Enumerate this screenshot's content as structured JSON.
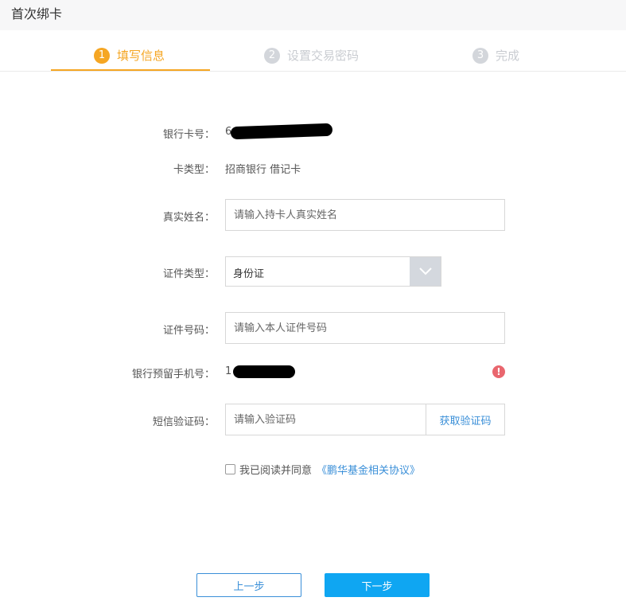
{
  "page": {
    "title": "首次绑卡"
  },
  "steps": [
    {
      "num": "1",
      "label": "填写信息",
      "active": true
    },
    {
      "num": "2",
      "label": "设置交易密码",
      "active": false
    },
    {
      "num": "3",
      "label": "完成",
      "active": false
    }
  ],
  "form": {
    "card_number": {
      "label": "银行卡号：",
      "value_prefix": "6"
    },
    "card_type": {
      "label": "卡类型：",
      "value": "招商银行 借记卡"
    },
    "real_name": {
      "label": "真实姓名：",
      "placeholder": "请输入持卡人真实姓名"
    },
    "id_type": {
      "label": "证件类型：",
      "value": "身份证"
    },
    "id_number": {
      "label": "证件号码：",
      "placeholder": "请输入本人证件号码"
    },
    "phone": {
      "label": "银行预留手机号：",
      "value_prefix": "1"
    },
    "sms_code": {
      "label": "短信验证码：",
      "placeholder": "请输入验证码",
      "button": "获取验证码"
    },
    "agreement": {
      "text": "我已阅读并同意",
      "link": "《鹏华基金相关协议》"
    }
  },
  "buttons": {
    "prev": "上一步",
    "next": "下一步"
  },
  "colors": {
    "accent": "#f5a623",
    "primary": "#0fa6f2",
    "link": "#3a8fd8",
    "warning": "#e9666e"
  }
}
